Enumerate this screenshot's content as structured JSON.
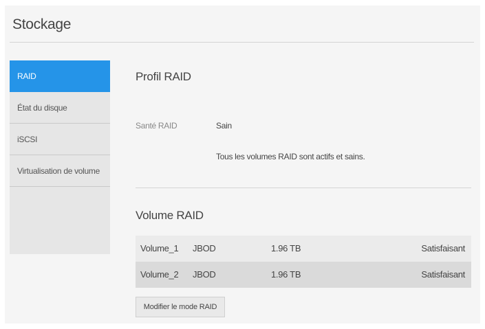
{
  "page": {
    "title": "Stockage"
  },
  "sidebar": {
    "items": [
      {
        "label": "RAID"
      },
      {
        "label": "État du disque"
      },
      {
        "label": "iSCSI"
      },
      {
        "label": "Virtualisation de volume"
      }
    ]
  },
  "raid_profile": {
    "title": "Profil RAID",
    "health_label": "Santé RAID",
    "health_value": "Sain",
    "health_message": "Tous les volumes RAID sont actifs et sains."
  },
  "raid_volume": {
    "title": "Volume RAID",
    "rows": [
      {
        "name": "Volume_1",
        "type": "JBOD",
        "size": "1.96 TB",
        "status": "Satisfaisant"
      },
      {
        "name": "Volume_2",
        "type": "JBOD",
        "size": "1.96 TB",
        "status": "Satisfaisant"
      }
    ],
    "modify_button": "Modifier le mode RAID"
  },
  "colors": {
    "accent": "#2594e8",
    "background": "#f5f5f5",
    "sidebar": "#e6e6e6"
  }
}
